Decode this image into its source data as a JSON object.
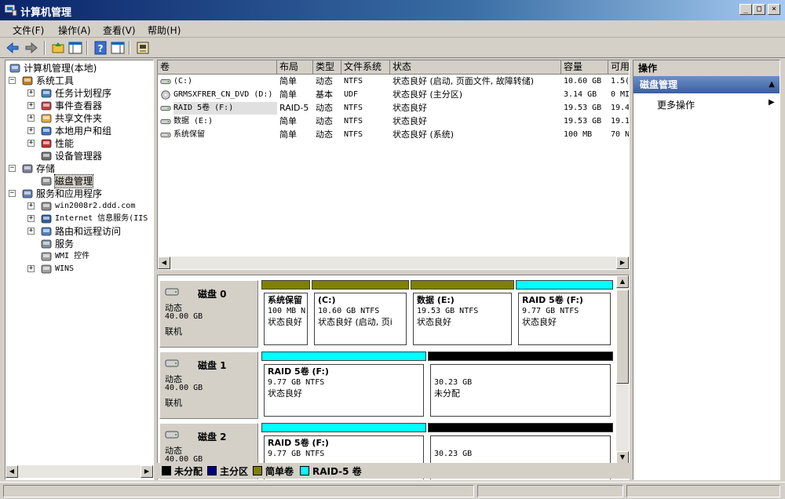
{
  "window": {
    "title": "计算机管理"
  },
  "menu": [
    "文件(F)",
    "操作(A)",
    "查看(V)",
    "帮助(H)"
  ],
  "tree": [
    {
      "label": "计算机管理(本地)",
      "level": 0,
      "expander": "",
      "icon": "computer-icon"
    },
    {
      "label": "系统工具",
      "level": 1,
      "expander": "−",
      "icon": "tools-icon"
    },
    {
      "label": "任务计划程序",
      "level": 2,
      "expander": "+",
      "icon": "clock-icon"
    },
    {
      "label": "事件查看器",
      "level": 2,
      "expander": "+",
      "icon": "event-viewer-icon"
    },
    {
      "label": "共享文件夹",
      "level": 2,
      "expander": "+",
      "icon": "shared-folder-icon"
    },
    {
      "label": "本地用户和组",
      "level": 2,
      "expander": "+",
      "icon": "users-icon"
    },
    {
      "label": "性能",
      "level": 2,
      "expander": "+",
      "icon": "performance-icon"
    },
    {
      "label": "设备管理器",
      "level": 2,
      "expander": "",
      "icon": "device-manager-icon"
    },
    {
      "label": "存储",
      "level": 1,
      "expander": "−",
      "icon": "storage-icon"
    },
    {
      "label": "磁盘管理",
      "level": 2,
      "expander": "",
      "icon": "disk-icon"
    },
    {
      "label": "服务和应用程序",
      "level": 1,
      "expander": "−",
      "icon": "services-apps-icon"
    },
    {
      "label": "win2008r2.ddd.com",
      "level": 2,
      "expander": "+",
      "icon": "server-icon"
    },
    {
      "label": "Internet 信息服务(IIS",
      "level": 2,
      "expander": "+",
      "icon": "iis-icon"
    },
    {
      "label": "路由和远程访问",
      "level": 2,
      "expander": "+",
      "icon": "routing-icon"
    },
    {
      "label": "服务",
      "level": 2,
      "expander": "",
      "icon": "services-icon"
    },
    {
      "label": "WMI 控件",
      "level": 2,
      "expander": "",
      "icon": "wmi-icon"
    },
    {
      "label": "WINS",
      "level": 2,
      "expander": "+",
      "icon": "wins-icon"
    }
  ],
  "volumes": {
    "columns": [
      "卷",
      "布局",
      "类型",
      "文件系统",
      "状态",
      "容量",
      "可用"
    ],
    "rows": [
      {
        "vol": "(C:)",
        "layout": "简单",
        "type": "动态",
        "fs": "NTFS",
        "status": "状态良好 (启动, 页面文件, 故障转储)",
        "cap": "10.60 GB",
        "free": "1.5("
      },
      {
        "vol": "GRMSXFRER_CN_DVD (D:)",
        "layout": "简单",
        "type": "基本",
        "fs": "UDF",
        "status": "状态良好 (主分区)",
        "cap": "3.14 GB",
        "free": "0 MI"
      },
      {
        "vol": "RAID 5卷 (F:)",
        "layout": "RAID-5",
        "type": "动态",
        "fs": "NTFS",
        "status": "状态良好",
        "cap": "19.53 GB",
        "free": "19.4"
      },
      {
        "vol": "数据 (E:)",
        "layout": "简单",
        "type": "动态",
        "fs": "NTFS",
        "status": "状态良好",
        "cap": "19.53 GB",
        "free": "19.1"
      },
      {
        "vol": "系统保留",
        "layout": "简单",
        "type": "动态",
        "fs": "NTFS",
        "status": "状态良好 (系统)",
        "cap": "100 MB",
        "free": "70 N"
      }
    ]
  },
  "colors": {
    "simple": "#808000",
    "raid5": "#00ffff",
    "unallocated": "#000000",
    "primary": "#000080"
  },
  "disks": [
    {
      "name": "磁盘 0",
      "type": "动态",
      "size": "40.00 GB",
      "status": "联机",
      "partitions": [
        {
          "kind": "simple",
          "name": "系统保留",
          "line2": "100 MB N",
          "line3": "状态良好"
        },
        {
          "kind": "simple",
          "name": "(C:)",
          "line2": "10.60 GB NTFS",
          "line3": "状态良好 (启动, 页i"
        },
        {
          "kind": "simple",
          "name": "数据 (E:)",
          "line2": "19.53 GB NTFS",
          "line3": "状态良好"
        },
        {
          "kind": "raid5",
          "name": "RAID 5卷 (F:)",
          "line2": "9.77 GB NTFS",
          "line3": "状态良好"
        }
      ]
    },
    {
      "name": "磁盘 1",
      "type": "动态",
      "size": "40.00 GB",
      "status": "联机",
      "partitions": [
        {
          "kind": "raid5",
          "name": "RAID 5卷 (F:)",
          "line2": "9.77 GB NTFS",
          "line3": "状态良好"
        },
        {
          "kind": "unallocated",
          "name": "",
          "line2": "30.23 GB",
          "line3": "未分配"
        }
      ]
    },
    {
      "name": "磁盘 2",
      "type": "动态",
      "size": "40.00 GB",
      "status": "",
      "partitions": [
        {
          "kind": "raid5",
          "name": "RAID 5卷 (F:)",
          "line2": "9.77 GB NTFS",
          "line3": ""
        },
        {
          "kind": "unallocated",
          "name": "",
          "line2": "30.23 GB",
          "line3": ""
        }
      ]
    }
  ],
  "legend": [
    "未分配",
    "主分区",
    "简单卷",
    "RAID-5 卷"
  ],
  "actions": {
    "header": "操作",
    "section": "磁盘管理",
    "more": "更多操作"
  }
}
